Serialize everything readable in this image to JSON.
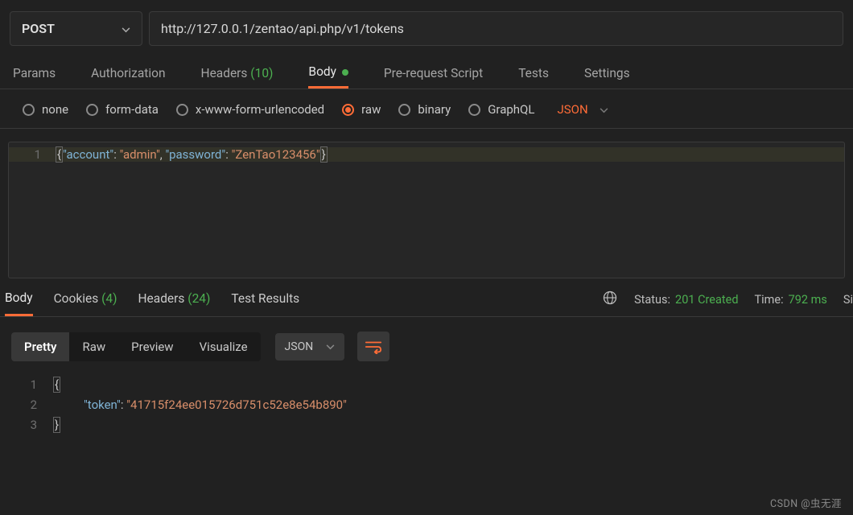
{
  "request": {
    "method": "POST",
    "url": "http://127.0.0.1/zentao/api.php/v1/tokens",
    "tabs": {
      "params": "Params",
      "authorization": "Authorization",
      "headers": "Headers",
      "headers_count": "(10)",
      "body": "Body",
      "prerequest": "Pre-request Script",
      "tests": "Tests",
      "settings": "Settings"
    },
    "body_types": {
      "none": "none",
      "formdata": "form-data",
      "xform": "x-www-form-urlencoded",
      "raw": "raw",
      "binary": "binary",
      "graphql": "GraphQL"
    },
    "raw_format": "JSON",
    "body_editor": {
      "line1_num": "1",
      "key1": "\"account\"",
      "val1": "\"admin\"",
      "key2": "\"password\"",
      "val2": "\"ZenTao123456\""
    }
  },
  "response": {
    "tabs": {
      "body": "Body",
      "cookies": "Cookies",
      "cookies_count": "(4)",
      "headers": "Headers",
      "headers_count": "(24)",
      "testresults": "Test Results"
    },
    "status_label": "Status:",
    "status_value": "201 Created",
    "time_label": "Time:",
    "time_value": "792 ms",
    "size_label": "Si",
    "views": {
      "pretty": "Pretty",
      "raw": "Raw",
      "preview": "Preview",
      "visualize": "Visualize"
    },
    "format": "JSON",
    "body_lines": {
      "l1_num": "1",
      "l2_num": "2",
      "l3_num": "3",
      "token_key": "\"token\"",
      "token_val": "\"41715f24ee015726d751c52e8e54b890\""
    }
  },
  "watermark": "CSDN @虫无涯"
}
